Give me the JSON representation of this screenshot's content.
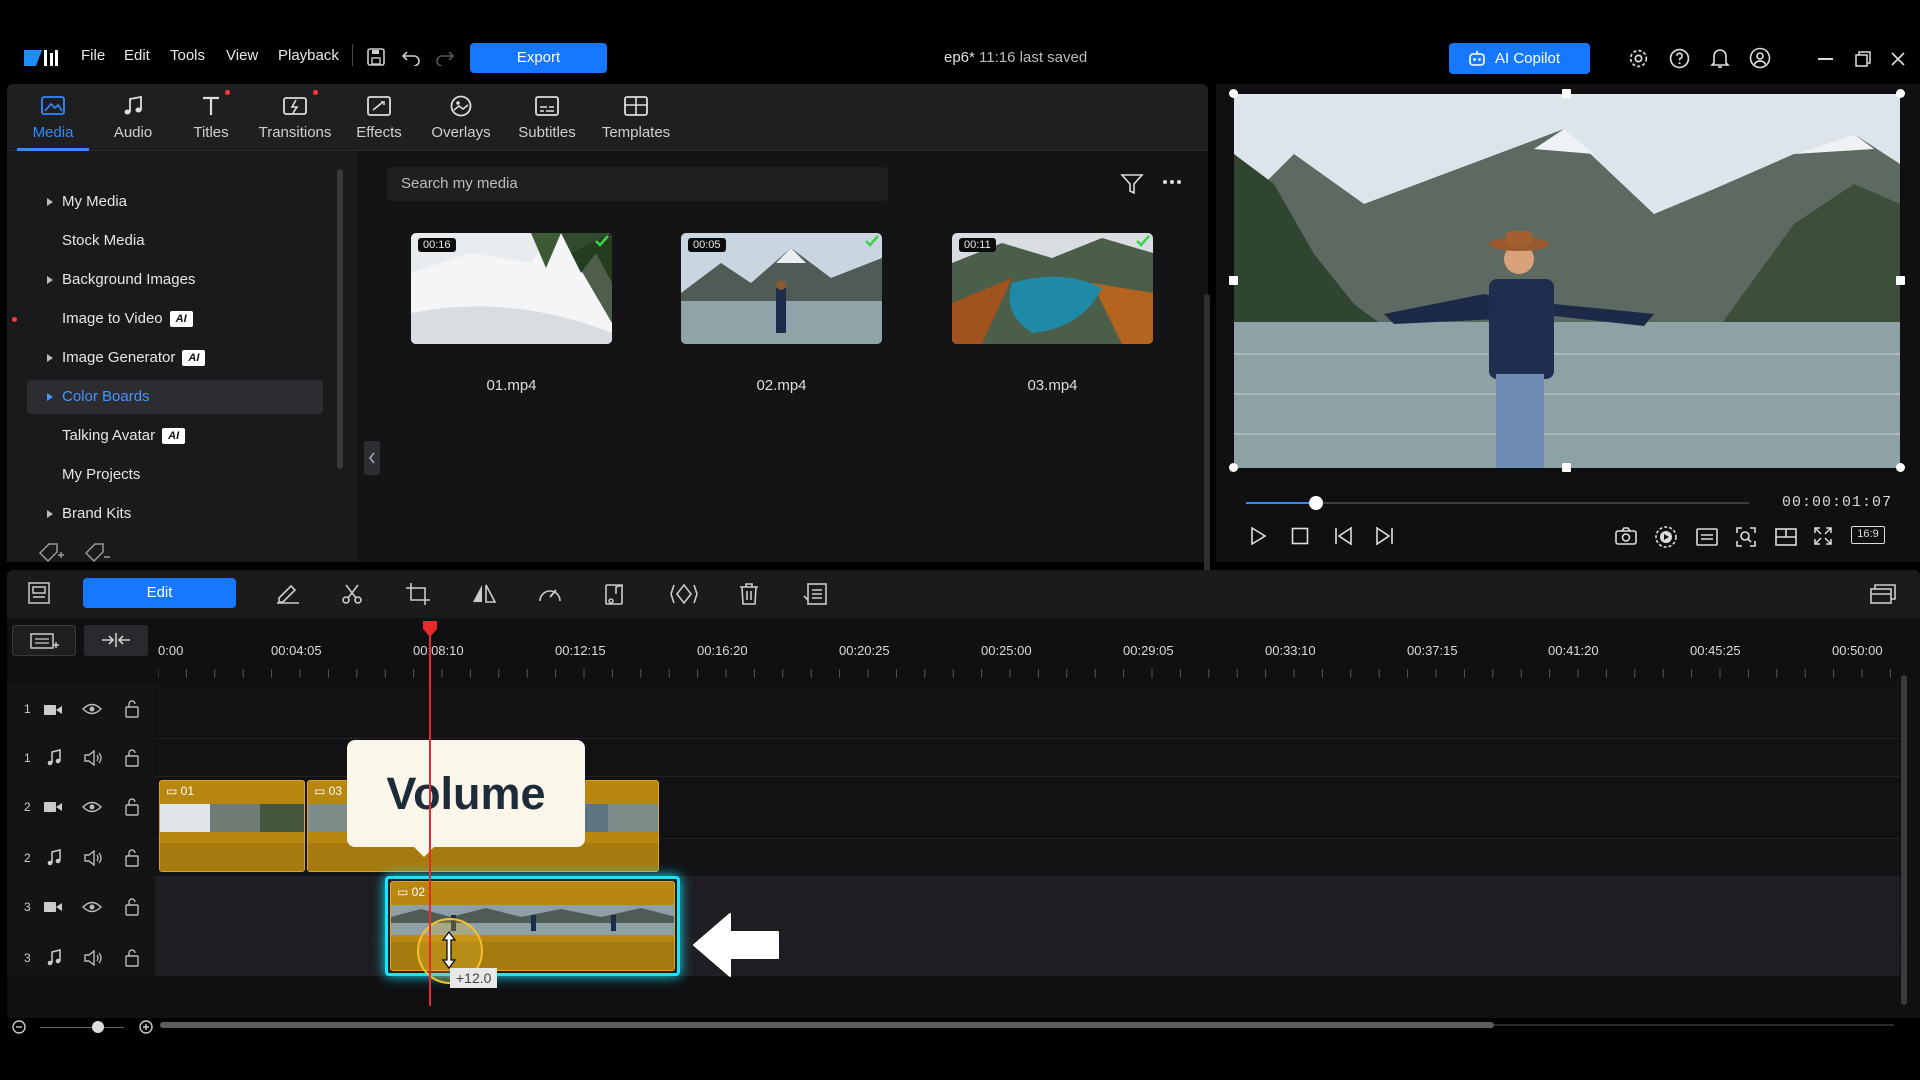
{
  "menu": {
    "file": "File",
    "edit": "Edit",
    "tools": "Tools",
    "view": "View",
    "playback": "Playback",
    "export": "Export"
  },
  "project": {
    "name": "ep6*",
    "saved": "11:16 last saved"
  },
  "ai_copilot": "AI Copilot",
  "tabs": [
    {
      "label": "Media",
      "icon": "media-icon"
    },
    {
      "label": "Audio",
      "icon": "audio-icon"
    },
    {
      "label": "Titles",
      "icon": "titles-icon"
    },
    {
      "label": "Transitions",
      "icon": "transitions-icon"
    },
    {
      "label": "Effects",
      "icon": "effects-icon"
    },
    {
      "label": "Overlays",
      "icon": "overlays-icon"
    },
    {
      "label": "Subtitles",
      "icon": "subtitles-icon"
    },
    {
      "label": "Templates",
      "icon": "templates-icon"
    }
  ],
  "sidebar": {
    "items": [
      {
        "label": "My Media"
      },
      {
        "label": "Stock Media"
      },
      {
        "label": "Background Images"
      },
      {
        "label": "Image to Video",
        "badge": "AI"
      },
      {
        "label": "Image Generator",
        "badge": "AI"
      },
      {
        "label": "Color Boards"
      },
      {
        "label": "Talking Avatar",
        "badge": "AI"
      },
      {
        "label": "My Projects"
      },
      {
        "label": "Brand Kits"
      }
    ]
  },
  "search": {
    "placeholder": "Search my media"
  },
  "media": [
    {
      "name": "01.mp4",
      "duration": "00:16"
    },
    {
      "name": "02.mp4",
      "duration": "00:05"
    },
    {
      "name": "03.mp4",
      "duration": "00:11"
    }
  ],
  "preview": {
    "timecode": "00:00:01:07",
    "progress": 0.14,
    "aspect": "16:9"
  },
  "timeline": {
    "edit_label": "Edit",
    "ruler": [
      "0:00",
      "00:04:05",
      "00:08:10",
      "00:12:15",
      "00:16:20",
      "00:20:25",
      "00:25:00",
      "00:29:05",
      "00:33:10",
      "00:37:15",
      "00:41:20",
      "00:45:25",
      "00:50:00"
    ],
    "tracks": [
      {
        "num": "1",
        "type": "video"
      },
      {
        "num": "1",
        "type": "audio"
      },
      {
        "num": "2",
        "type": "video"
      },
      {
        "num": "2",
        "type": "audio"
      },
      {
        "num": "3",
        "type": "video"
      },
      {
        "num": "3",
        "type": "audio"
      }
    ],
    "clips": {
      "clip_a": "01",
      "clip_b": "03",
      "clip_c": "02"
    },
    "tooltip": "Volume",
    "volume_value": "+12.0"
  },
  "colors": {
    "accent": "#1677ff",
    "clip": "#b8870f",
    "highlight": "#14e6ff",
    "playhead": "#e8282b"
  }
}
